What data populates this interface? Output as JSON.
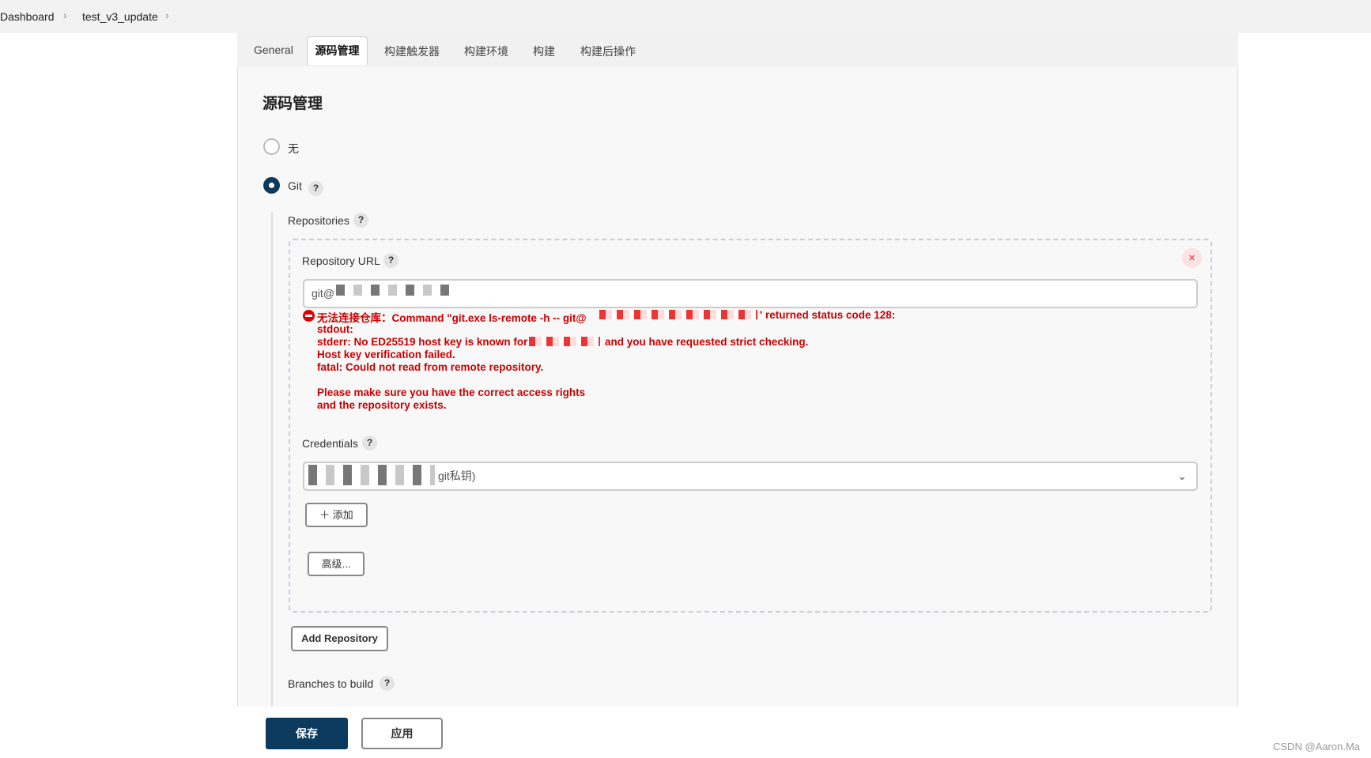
{
  "breadcrumb": {
    "items": [
      "Dashboard",
      "test_v3_update"
    ]
  },
  "tabs": [
    "General",
    "源码管理",
    "构建触发器",
    "构建环境",
    "构建",
    "构建后操作"
  ],
  "section_title": "源码管理",
  "scm": {
    "none_label": "无",
    "git_label": "Git",
    "selected": "Git"
  },
  "repositories_label": "Repositories",
  "repository_url": {
    "label": "Repository URL",
    "value": "git@"
  },
  "error": {
    "line1_prefix": "无法连接仓库：Command \"git.exe ls-remote -h -- git@",
    "line1_suffix": "' returned status code 128:",
    "line2": "stdout:",
    "line3_prefix": "stderr: No ED25519 host key is known for",
    "line3_suffix": "and you have requested strict checking.",
    "line4": "Host key verification failed.",
    "line5": "fatal: Could not read from remote repository.",
    "line6": "Please make sure you have the correct access rights",
    "line7": "and the repository exists."
  },
  "credentials": {
    "label": "Credentials",
    "value_suffix": "git私钥)"
  },
  "buttons": {
    "add": "添加",
    "advanced": "高级...",
    "add_repository": "Add Repository",
    "save": "保存",
    "apply": "应用"
  },
  "branches_label": "Branches to build",
  "help_glyph": "?",
  "close_glyph": "×",
  "watermark": "CSDN @Aaron.Ma",
  "colors": {
    "primary": "#0b3a5e",
    "error": "#cc0000"
  }
}
